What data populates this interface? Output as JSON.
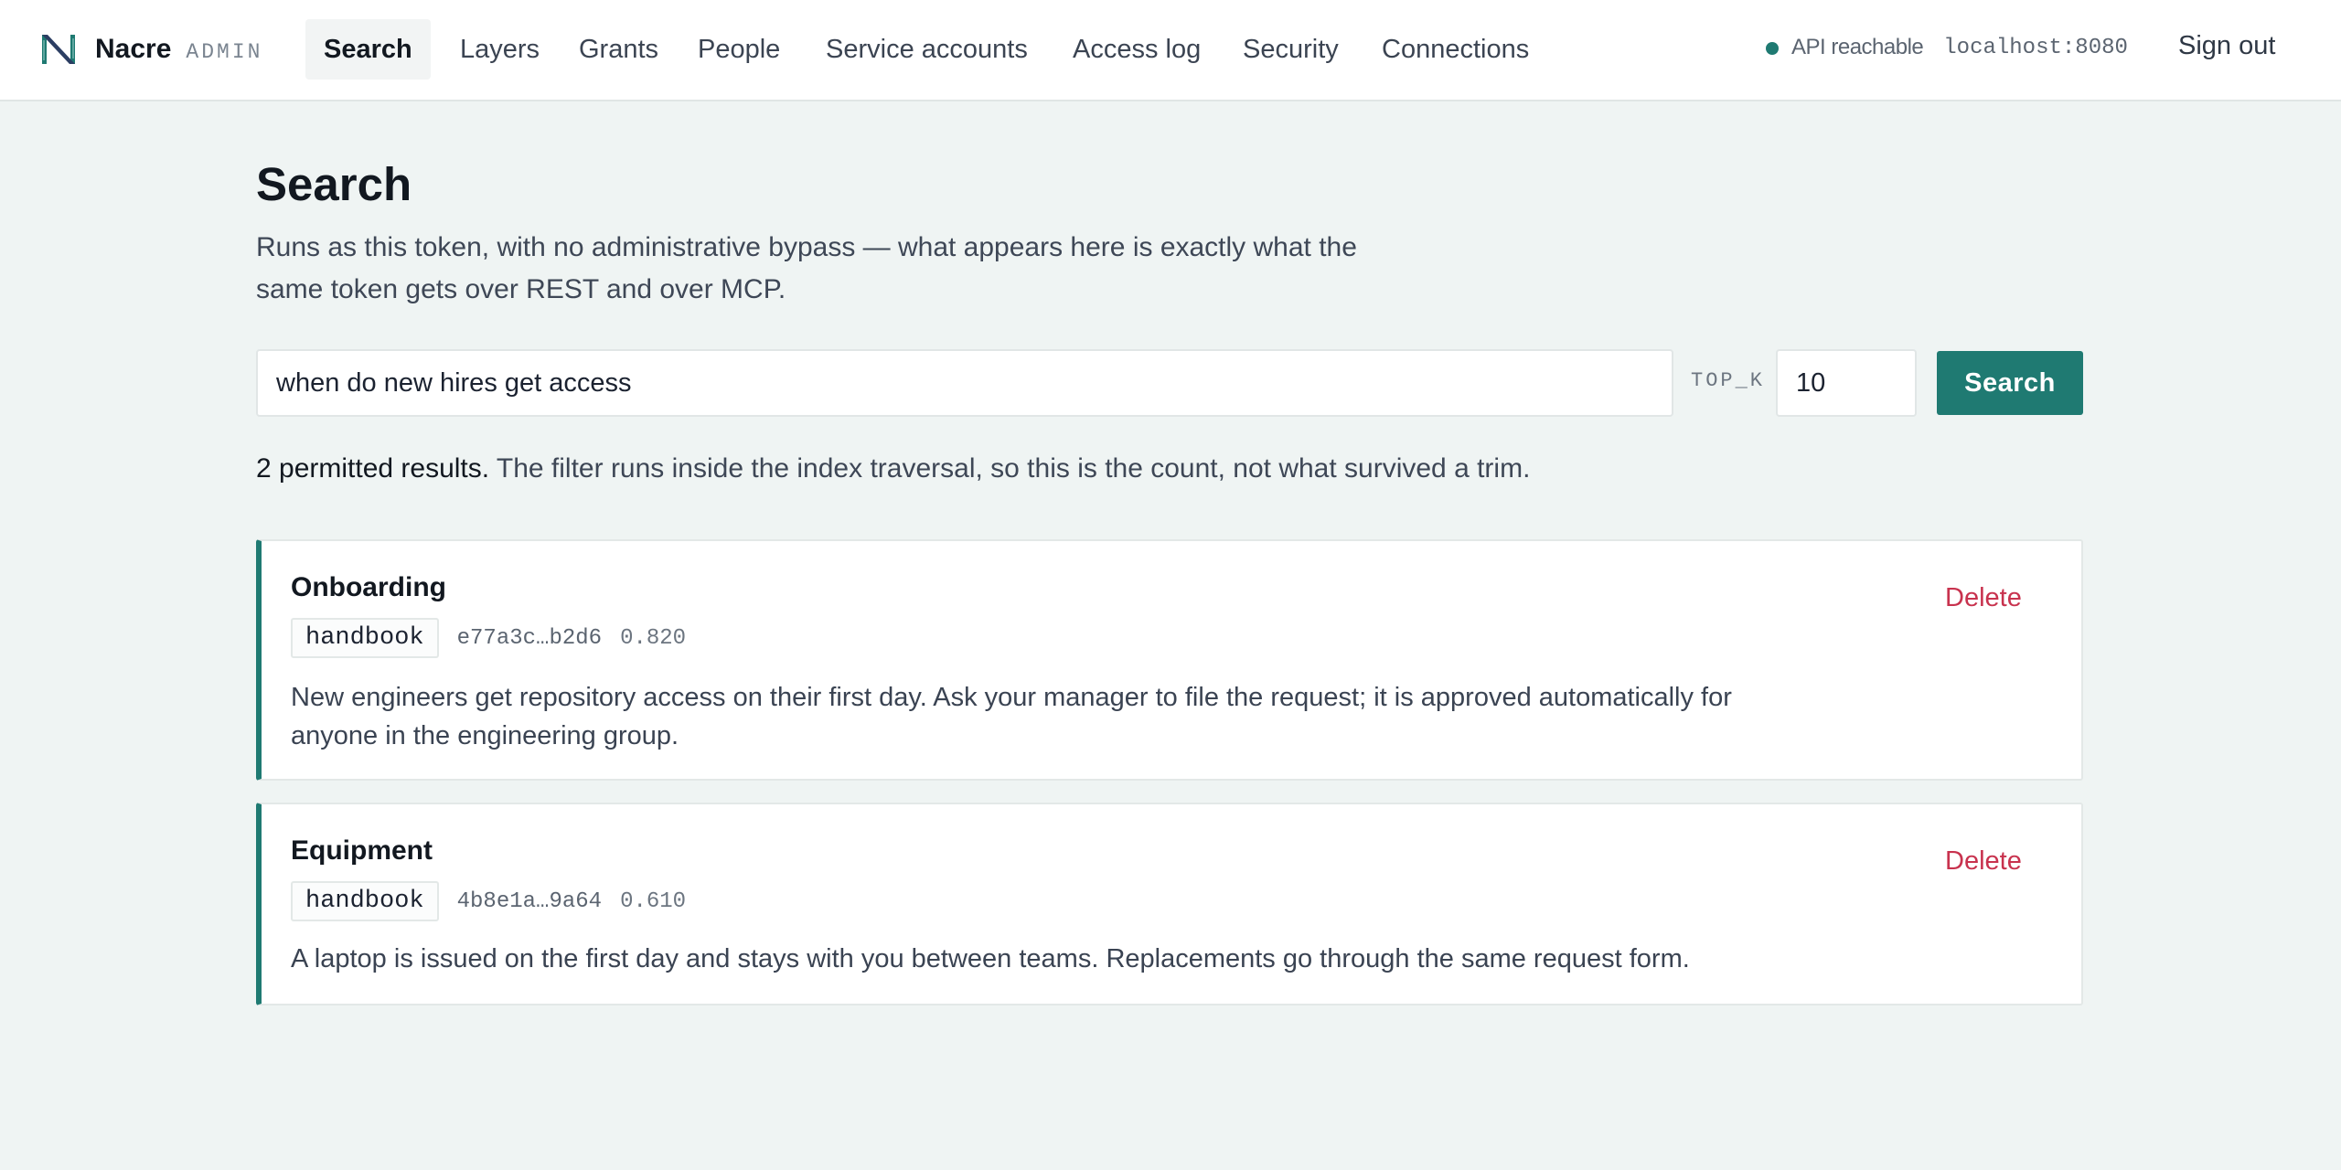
{
  "header": {
    "brand_name": "Nacre",
    "brand_tag": "ADMIN",
    "logo_icon": "nacre-logo-icon",
    "nav": [
      {
        "label": "Search",
        "active": true
      },
      {
        "label": "Layers"
      },
      {
        "label": "Grants"
      },
      {
        "label": "People"
      },
      {
        "label": "Service accounts"
      },
      {
        "label": "Access log"
      },
      {
        "label": "Security"
      },
      {
        "label": "Connections"
      }
    ],
    "status_text": "API reachable",
    "status_host": "localhost:8080",
    "signout_label": "Sign out"
  },
  "main": {
    "title": "Search",
    "subtitle": "Runs as this token, with no administrative bypass — what appears here is exactly what the same token gets over REST and over MCP.",
    "query_value": "when do new hires get access",
    "topk_label": "TOP_K",
    "topk_value": "10",
    "search_button_label": "Search",
    "result_count_strong": "2 permitted results.",
    "result_count_rest": " The filter runs inside the index traversal, so this is the count, not what survived a trim.",
    "results": [
      {
        "title": "Onboarding",
        "tag": "handbook",
        "id": "e77a3c…b2d6",
        "score": "0.820",
        "body": "New engineers get repository access on their first day. Ask your manager to file the request; it is approved automatically for anyone in the engineering group.",
        "delete_label": "Delete"
      },
      {
        "title": "Equipment",
        "tag": "handbook",
        "id": "4b8e1a…9a64",
        "score": "0.610",
        "body": "A laptop is issued on the first day and stays with you between teams. Replacements go through the same request form.",
        "delete_label": "Delete"
      }
    ]
  },
  "colors": {
    "accent": "#1f7a72",
    "danger": "#c8324e",
    "background": "#eff4f3"
  }
}
